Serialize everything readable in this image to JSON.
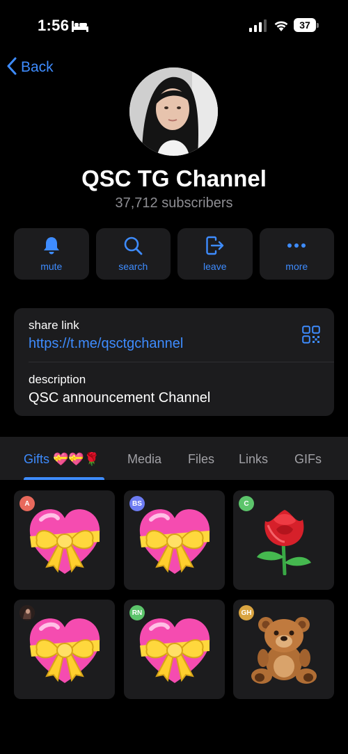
{
  "status_bar": {
    "time": "1:56",
    "battery": "37"
  },
  "nav": {
    "back_label": "Back"
  },
  "channel": {
    "title": "QSC TG Channel",
    "subscribers": "37,712 subscribers"
  },
  "actions": [
    {
      "label": "mute",
      "icon": "bell-icon"
    },
    {
      "label": "search",
      "icon": "search-icon"
    },
    {
      "label": "leave",
      "icon": "leave-icon"
    },
    {
      "label": "more",
      "icon": "more-icon"
    }
  ],
  "info": {
    "share_link_label": "share link",
    "share_link_value": "https://t.me/qsctgchannel",
    "description_label": "description",
    "description_value": "QSC announcement Channel"
  },
  "tabs": [
    {
      "label": "Gifts 💝💝🌹",
      "active": true
    },
    {
      "label": "Media",
      "active": false
    },
    {
      "label": "Files",
      "active": false
    },
    {
      "label": "Links",
      "active": false
    },
    {
      "label": "GIFs",
      "active": false
    }
  ],
  "gifts": [
    {
      "badge": "A",
      "badge_color": "#e8695c",
      "item": "heart-with-ribbon"
    },
    {
      "badge": "BS",
      "badge_color": "#6d7cf2",
      "item": "heart-with-ribbon"
    },
    {
      "badge": "C",
      "badge_color": "#5cc46b",
      "item": "rose"
    },
    {
      "badge": "",
      "badge_color": "#3a2a26",
      "item": "heart-with-ribbon"
    },
    {
      "badge": "RN",
      "badge_color": "#5cc46b",
      "item": "heart-with-ribbon"
    },
    {
      "badge": "GH",
      "badge_color": "#d9a441",
      "item": "teddy-bear"
    }
  ],
  "colors": {
    "accent": "#3e8cff",
    "card": "#1c1c1e",
    "background": "#000000",
    "secondary_text": "#8e8e93"
  }
}
